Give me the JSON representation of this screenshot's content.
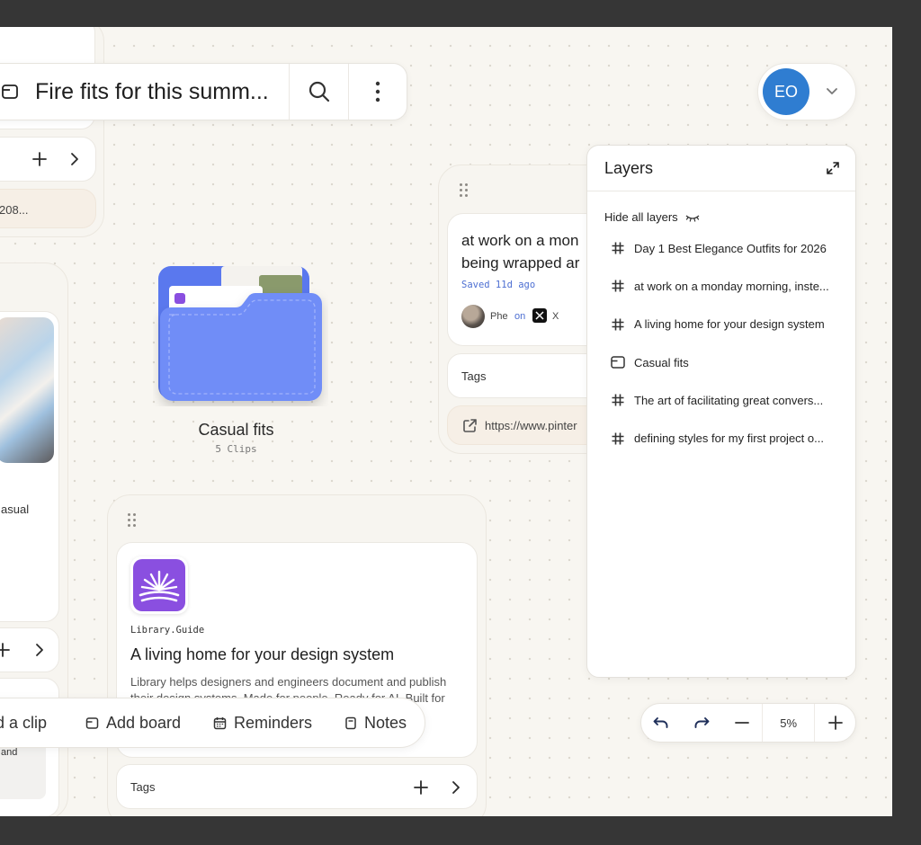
{
  "board": {
    "title": "Fire fits for this summ..."
  },
  "user": {
    "initials": "EO",
    "avatar_color": "#2f7dd1"
  },
  "left_column": {
    "top_url_fragment": "208...",
    "casual_fragment": "asual",
    "and_fragment": "and"
  },
  "folder": {
    "name": "Casual fits",
    "count": "5 Clips",
    "color": "#6f8df7"
  },
  "clip_card": {
    "title_line1": "at work on a mon",
    "title_line2": "being wrapped ar",
    "saved": "Saved 11d ago",
    "author": "Phe",
    "on": "on",
    "platform": "X",
    "tags_label": "Tags",
    "url": "https://www.pinter"
  },
  "library_card": {
    "site": "Library.Guide",
    "title": "A living home for your design system",
    "desc_line1": "Library helps designers and engineers document and publish",
    "desc_line2": "their design systems. Made for people. Ready for AI. Built for",
    "tags_label": "Tags",
    "logo_color": "#8a4fe0"
  },
  "layers": {
    "title": "Layers",
    "hide_all": "Hide all layers",
    "items": [
      {
        "icon": "hash-icon",
        "label": "Day 1 Best Elegance Outfits for 2026"
      },
      {
        "icon": "hash-icon",
        "label": "at work on a monday morning, inste..."
      },
      {
        "icon": "hash-icon",
        "label": "A living home for your design system"
      },
      {
        "icon": "folder-icon",
        "label": "Casual fits"
      },
      {
        "icon": "hash-icon",
        "label": "The art of facilitating great convers..."
      },
      {
        "icon": "hash-icon",
        "label": "defining styles for my first project o..."
      }
    ]
  },
  "toolbar": {
    "add_clip": "d a clip",
    "add_board": "Add board",
    "reminders": "Reminders",
    "notes": "Notes"
  },
  "zoom": {
    "value": "5%"
  }
}
